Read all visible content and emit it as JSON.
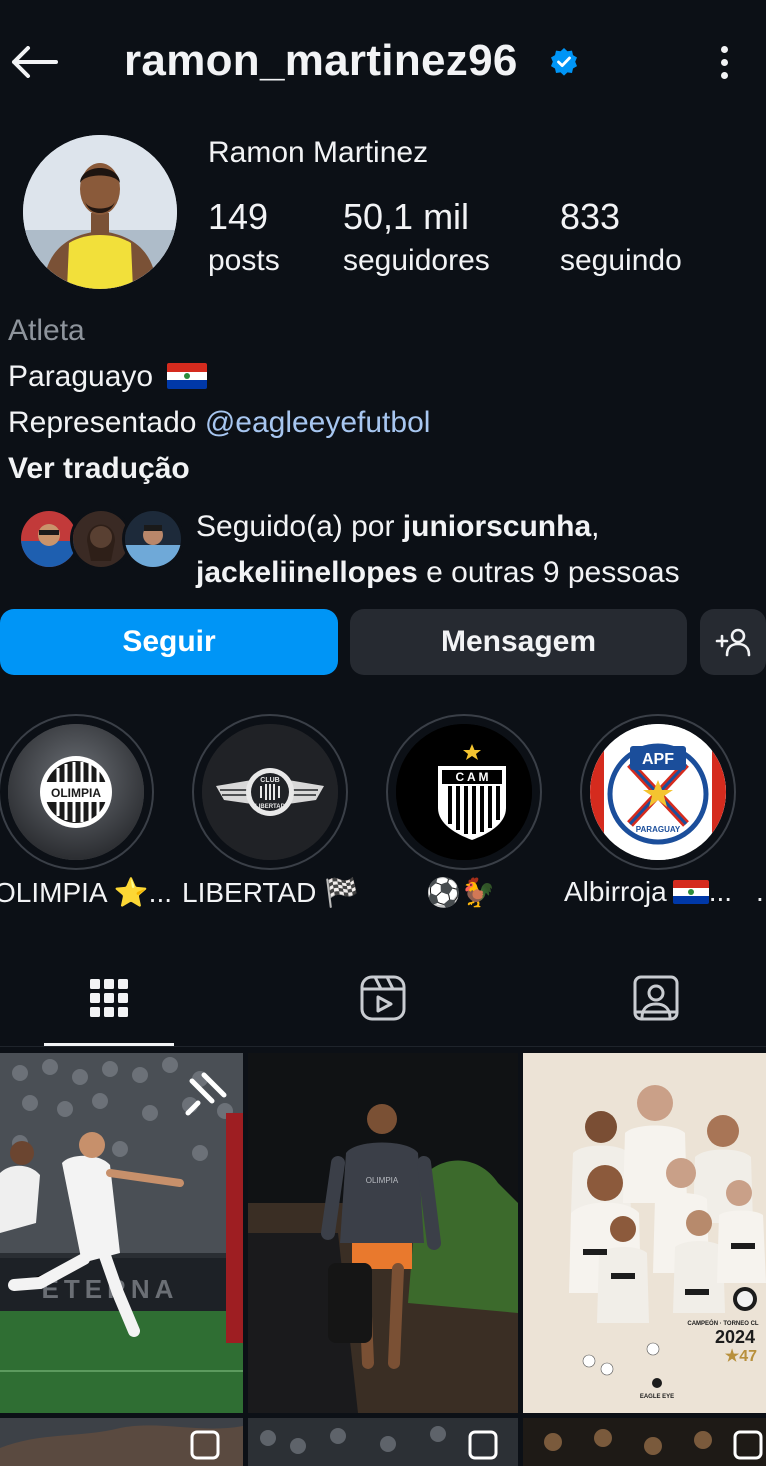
{
  "header": {
    "username": "ramon_martinez96",
    "verified": true
  },
  "profile": {
    "display_name": "Ramon Martinez",
    "stats": [
      {
        "value": "149",
        "label": "posts"
      },
      {
        "value": "50,1 mil",
        "label": "seguidores"
      },
      {
        "value": "833",
        "label": "seguindo"
      }
    ]
  },
  "bio": {
    "category": "Atleta",
    "origin": "Paraguayo",
    "represented_prefix": "Representado",
    "represented_handle": "@eagleeyefutbol",
    "see_translation": "Ver tradução"
  },
  "followed_by": {
    "prefix": "Seguido(a) por ",
    "user1": "juniorscunha",
    "separator": ",",
    "user2": "jackeliinellopes",
    "suffix": " e outras 9 pessoas"
  },
  "actions": {
    "follow": "Seguir",
    "message": "Mensagem"
  },
  "highlights": [
    {
      "label": "OLIMPIA ⭐..."
    },
    {
      "label": "LIBERTAD 🏁"
    },
    {
      "label": "⚽🐓"
    },
    {
      "label": "Albirroja"
    },
    {
      "label": "..."
    }
  ],
  "highlight_art": {
    "olimpia": "OLIMPIA",
    "libertad_top": "CLUB",
    "libertad_bottom": "LIBERTAD",
    "cam": "C A M",
    "apf": "APF",
    "apf_bottom": "PARAGUAY"
  },
  "posts": [
    {
      "banner": "ETERNA"
    },
    {
      "shirt": "OLIMPIA"
    },
    {
      "caption_top": "CAMPEÓN · TORNEO CL",
      "year": "2024",
      "stars": "★47",
      "brand": "EAGLE EYE"
    }
  ],
  "colors": {
    "background": "#0c1016",
    "accent": "#0095f6",
    "link": "#a7c6f0",
    "verified": "#0095f6",
    "secondary_button": "#262a31"
  }
}
